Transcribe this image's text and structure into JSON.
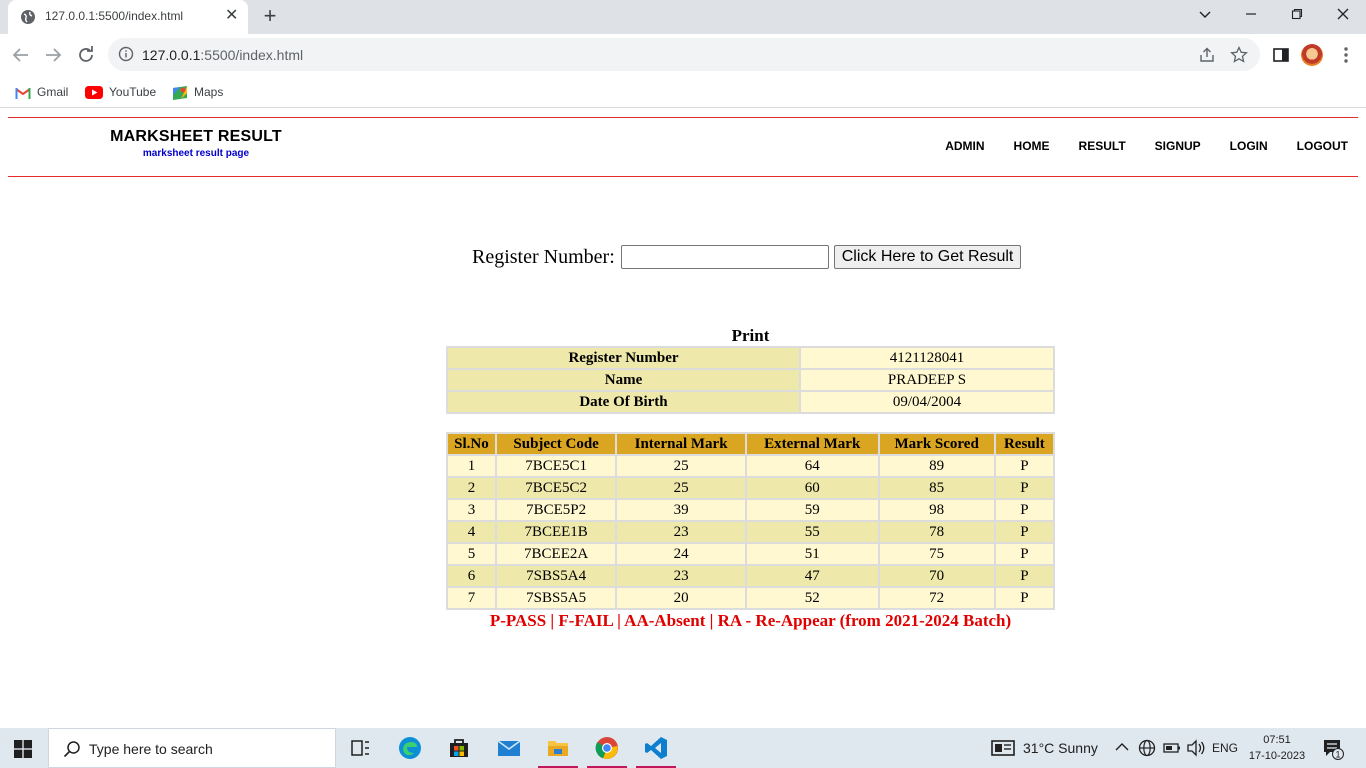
{
  "browser": {
    "tab_title": "127.0.0.1:5500/index.html",
    "tab_close": "✕",
    "new_tab": "+",
    "url_host": "127.0.0.1",
    "url_path": ":5500/index.html",
    "bookmarks": [
      {
        "label": "Gmail",
        "icon": "gmail-icon"
      },
      {
        "label": "YouTube",
        "icon": "youtube-icon"
      },
      {
        "label": "Maps",
        "icon": "maps-icon"
      }
    ]
  },
  "header": {
    "title": "MARKSHEET RESULT",
    "subtitle": "marksheet result page",
    "nav": [
      "ADMIN",
      "HOME",
      "RESULT",
      "SIGNUP",
      "LOGIN",
      "LOGOUT"
    ]
  },
  "search": {
    "label": "Register Number:",
    "value": "",
    "button": "Click Here to Get Result"
  },
  "print_label": "Print",
  "student": [
    {
      "key": "Register Number",
      "value": "4121128041"
    },
    {
      "key": "Name",
      "value": "PRADEEP S"
    },
    {
      "key": "Date Of Birth",
      "value": "09/04/2004"
    }
  ],
  "marks": {
    "headers": [
      "Sl.No",
      "Subject Code",
      "Internal Mark",
      "External Mark",
      "Mark Scored",
      "Result"
    ],
    "rows": [
      [
        "1",
        "7BCE5C1",
        "25",
        "64",
        "89",
        "P"
      ],
      [
        "2",
        "7BCE5C2",
        "25",
        "60",
        "85",
        "P"
      ],
      [
        "3",
        "7BCE5P2",
        "39",
        "59",
        "98",
        "P"
      ],
      [
        "4",
        "7BCEE1B",
        "23",
        "55",
        "78",
        "P"
      ],
      [
        "5",
        "7BCEE2A",
        "24",
        "51",
        "75",
        "P"
      ],
      [
        "6",
        "7SBS5A4",
        "23",
        "47",
        "70",
        "P"
      ],
      [
        "7",
        "7SBS5A5",
        "20",
        "52",
        "72",
        "P"
      ]
    ]
  },
  "legend": "P-PASS | F-FAIL | AA-Absent | RA - Re-Appear (from 2021-2024 Batch)",
  "taskbar": {
    "search_placeholder": "Type here to search",
    "weather": "31°C  Sunny",
    "language": "ENG",
    "time": "07:51",
    "date": "17-10-2023",
    "notification_count": "1"
  },
  "colors": {
    "header_rule": "#e52b2b",
    "key_cell": "#eee8aa",
    "value_cell": "#fff8d0",
    "table_header": "#daa520",
    "legend_text": "#e00000",
    "subtitle_text": "#0000cc"
  }
}
